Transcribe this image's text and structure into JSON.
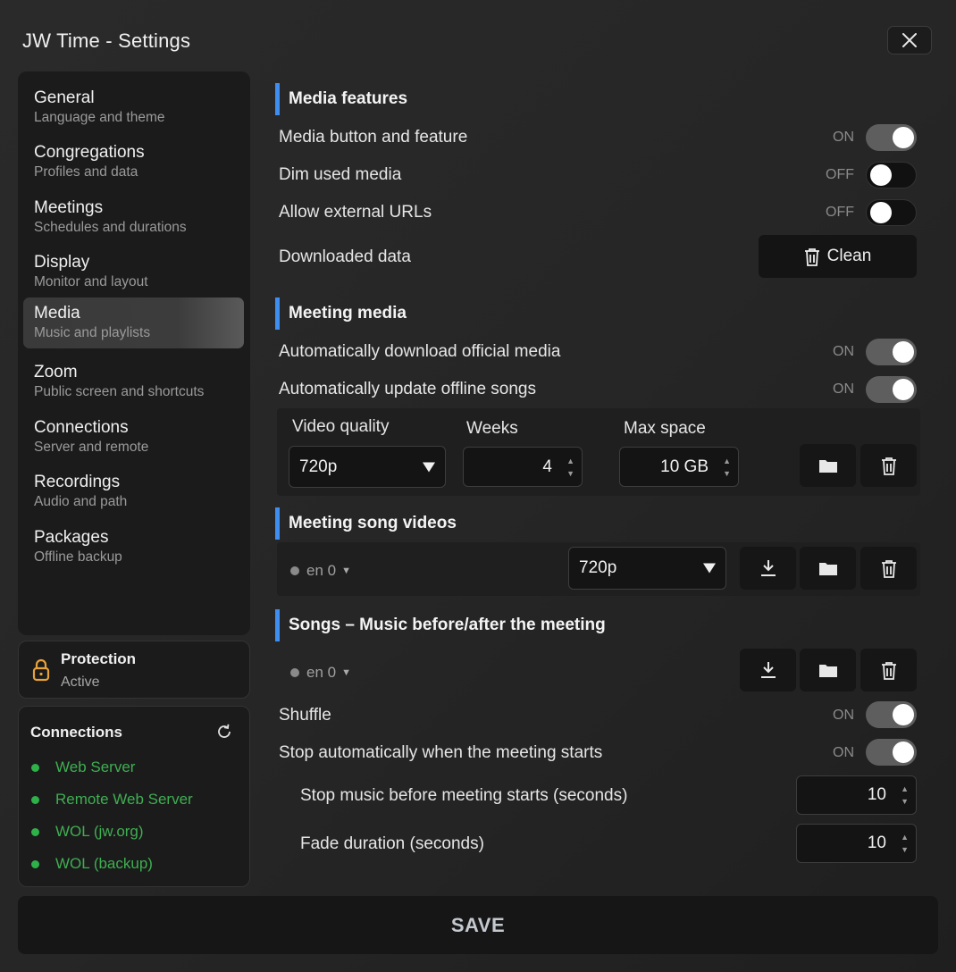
{
  "window": {
    "title": "JW Time - Settings"
  },
  "sidebar": {
    "items": [
      {
        "label": "General",
        "sub": "Language and theme"
      },
      {
        "label": "Congregations",
        "sub": "Profiles and data"
      },
      {
        "label": "Meetings",
        "sub": "Schedules and durations"
      },
      {
        "label": "Display",
        "sub": "Monitor and layout"
      },
      {
        "label": "Media",
        "sub": "Music and playlists"
      },
      {
        "label": "Zoom",
        "sub": "Public screen and shortcuts"
      },
      {
        "label": "Connections",
        "sub": "Server and remote"
      },
      {
        "label": "Recordings",
        "sub": "Audio and path"
      },
      {
        "label": "Packages",
        "sub": "Offline backup"
      }
    ],
    "active_index": 4
  },
  "protection": {
    "title": "Protection",
    "status": "Active"
  },
  "connections": {
    "title": "Connections",
    "items": [
      "Web Server",
      "Remote Web Server",
      "WOL (jw.org)",
      "WOL (backup)"
    ],
    "status_color": "#2fb14a"
  },
  "media_features": {
    "title": "Media features",
    "media_button": {
      "label": "Media button and feature",
      "state": "ON"
    },
    "dim_used": {
      "label": "Dim used media",
      "state": "OFF"
    },
    "external_urls": {
      "label": "Allow external URLs",
      "state": "OFF"
    },
    "downloaded": {
      "label": "Downloaded data",
      "button": "Clean"
    }
  },
  "meeting_media": {
    "title": "Meeting media",
    "auto_download": {
      "label": "Automatically download official media",
      "state": "ON"
    },
    "auto_update": {
      "label": "Automatically update offline songs",
      "state": "ON"
    },
    "video_quality": {
      "label": "Video quality",
      "value": "720p"
    },
    "weeks": {
      "label": "Weeks",
      "value": "4"
    },
    "max_space": {
      "label": "Max space",
      "value": "10 GB"
    }
  },
  "meeting_song_videos": {
    "title": "Meeting song videos",
    "lang": "en 0",
    "quality": "720p"
  },
  "songs": {
    "title": "Songs – Music before/after the meeting",
    "lang": "en 0",
    "shuffle": {
      "label": "Shuffle",
      "state": "ON"
    },
    "stop_auto": {
      "label": "Stop automatically when the meeting starts",
      "state": "ON"
    },
    "stop_before": {
      "label": "Stop music before meeting starts (seconds)",
      "value": "10"
    },
    "fade": {
      "label": "Fade duration (seconds)",
      "value": "10"
    }
  },
  "save_label": "SAVE",
  "colors": {
    "accent": "#3d8ef0",
    "lock": "#e8a23a"
  }
}
